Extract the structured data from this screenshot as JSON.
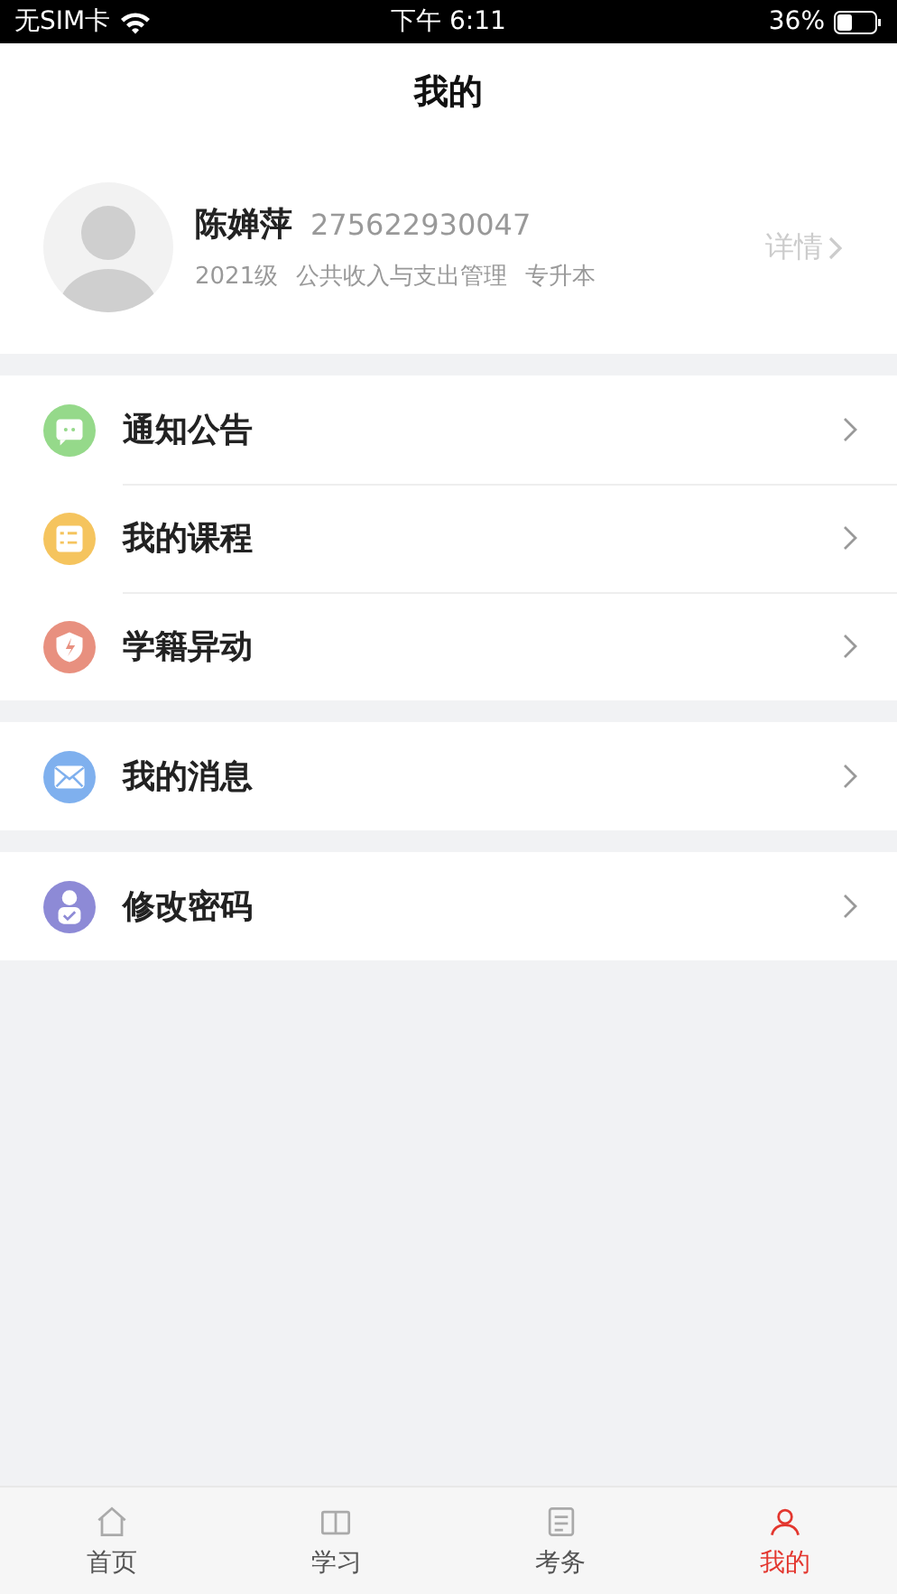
{
  "status_bar": {
    "carrier": "无SIM卡",
    "time": "下午 6:11",
    "battery": "36%"
  },
  "nav": {
    "title": "我的"
  },
  "profile": {
    "name": "陈婵萍",
    "student_id": "275622930047",
    "grade": "2021级",
    "major": "公共收入与支出管理",
    "level": "专升本",
    "details_link": "详情"
  },
  "menu_groups": [
    {
      "items": [
        {
          "label": "通知公告",
          "kind": "notice",
          "color": "#95d98a"
        },
        {
          "label": "我的课程",
          "kind": "course",
          "color": "#f5c45e"
        },
        {
          "label": "学籍异动",
          "kind": "status",
          "color": "#e8907f"
        }
      ]
    },
    {
      "items": [
        {
          "label": "我的消息",
          "kind": "message",
          "color": "#7fb0ee"
        }
      ]
    },
    {
      "items": [
        {
          "label": "修改密码",
          "kind": "password",
          "color": "#8d8ad6"
        }
      ]
    }
  ],
  "tab_bar": [
    {
      "label": "首页",
      "kind": "home",
      "selected": false
    },
    {
      "label": "学习",
      "kind": "study",
      "selected": false
    },
    {
      "label": "考务",
      "kind": "exam",
      "selected": false
    },
    {
      "label": "我的",
      "kind": "me",
      "selected": true
    }
  ]
}
